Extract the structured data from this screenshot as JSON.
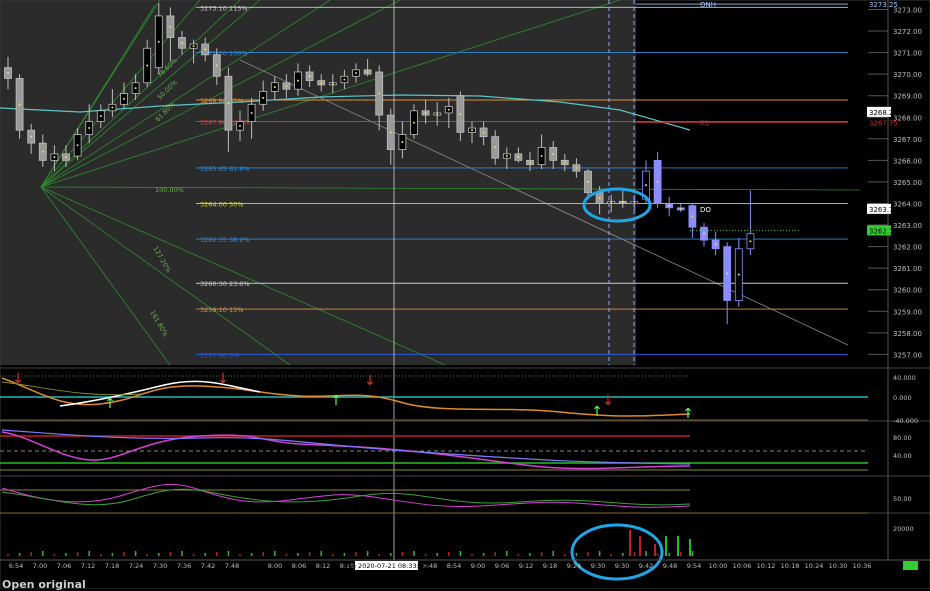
{
  "footer": {
    "open_original": "Open original"
  },
  "colors": {
    "background": "#000000",
    "premarket_bg": "#2b2b2b",
    "rth_bg": "#000000",
    "grid": "#4a4a4a",
    "accent_circle": "#1ea7e8"
  },
  "chart_data": {
    "type": "candlestick",
    "symbol_hint": "S&P futures intraday, 2020-07-21",
    "price_axis": {
      "range": [
        3256.6,
        3273.3
      ],
      "ticks": [
        "3273.00",
        "3272.00",
        "3271.00",
        "3270.00",
        "3269.00",
        "3268.00",
        "3267.00",
        "3266.00",
        "3265.00",
        "3264.00",
        "3263.00",
        "3262.00",
        "3261.00",
        "3260.00",
        "3259.00",
        "3258.00",
        "3257.00"
      ],
      "labels": [
        {
          "text": "3273.25",
          "value": 3273.25,
          "color": "#9fc3ff",
          "style": "plain"
        },
        {
          "text": "3268.25",
          "value": 3268.25,
          "color": "#000000",
          "bg": "#ffffff",
          "style": "box"
        },
        {
          "text": "3267.75",
          "value": 3267.75,
          "color": "#c03030",
          "style": "plain"
        },
        {
          "text": "3263.75",
          "value": 3263.75,
          "color": "#000000",
          "bg": "#ffffff",
          "style": "box"
        },
        {
          "text": "3262.75",
          "value": 3262.75,
          "color": "#000000",
          "bg": "#33cc33",
          "style": "box"
        }
      ]
    },
    "time_axis": {
      "ticks": [
        "6:54",
        "7:00",
        "7:06",
        "7:12",
        "7:18",
        "7:24",
        "7:30",
        "7:36",
        "7:42",
        "7:48",
        "8:00",
        "8:06",
        "8:12",
        "8:18",
        "8:48",
        "8:54",
        "9:00",
        "9:06",
        "9:12",
        "9:18",
        "9:24",
        "9:30",
        "9:30",
        "9:42",
        "9:48",
        "9:54",
        "10:00",
        "10:06",
        "10:12",
        "10:18",
        "10:24",
        "10:30",
        "10:36"
      ],
      "crosshair_label": "Tue 2020-07-21 08:33:00"
    },
    "fib_levels": [
      {
        "label": "3273.10 115%",
        "value": 3273.1,
        "color": "#c9c9c9"
      },
      {
        "label": "3271.00 100%",
        "value": 3271.0,
        "color": "#2e8ad8"
      },
      {
        "label": "3268.80 85%",
        "value": 3268.8,
        "color": "#e0903a"
      },
      {
        "label": "3267.80 76.4%",
        "value": 3267.8,
        "color": "#d84040"
      },
      {
        "label": "3265.65 61.8%",
        "value": 3265.65,
        "color": "#2e8ad8"
      },
      {
        "label": "3264.00 50%",
        "value": 3264.0,
        "color": "#d8d830"
      },
      {
        "label": "3262.35 38.2%",
        "value": 3262.35,
        "color": "#2e8ad8"
      },
      {
        "label": "3260.30 23.6%",
        "value": 3260.3,
        "color": "#c9c9c9"
      },
      {
        "label": "3259.10 15%",
        "value": 3259.1,
        "color": "#e0903a"
      },
      {
        "label": "3257.00 0%",
        "value": 3257.0,
        "color": "#2e5ad8"
      }
    ],
    "fan_labels": [
      {
        "text": "78.60%",
        "color": "#6ab04c"
      },
      {
        "text": "50.00%",
        "color": "#6ab04c"
      },
      {
        "text": "61.80%",
        "color": "#6ab04c"
      },
      {
        "text": "100.00%",
        "color": "#6ab04c"
      },
      {
        "text": "127.20%",
        "color": "#6ab04c"
      },
      {
        "text": "161.80%",
        "color": "#6ab04c"
      }
    ],
    "markers": [
      {
        "text": "ONH",
        "value": 3273.25,
        "color": "#9fc3ff"
      },
      {
        "text": "R1",
        "value": 3267.75,
        "color": "#c03030"
      },
      {
        "text": "DO",
        "value": 3263.75,
        "color": "#ffffff"
      }
    ],
    "candles": [
      {
        "t": 0,
        "o": 3270.3,
        "h": 3270.8,
        "l": 3269.3,
        "c": 3269.8
      },
      {
        "t": 1,
        "o": 3269.8,
        "h": 3270.0,
        "l": 3267.0,
        "c": 3267.4
      },
      {
        "t": 2,
        "o": 3267.4,
        "h": 3267.7,
        "l": 3266.3,
        "c": 3266.8
      },
      {
        "t": 3,
        "o": 3266.8,
        "h": 3267.2,
        "l": 3265.7,
        "c": 3266.0
      },
      {
        "t": 4,
        "o": 3266.0,
        "h": 3266.7,
        "l": 3265.5,
        "c": 3266.3
      },
      {
        "t": 5,
        "o": 3266.3,
        "h": 3266.7,
        "l": 3265.7,
        "c": 3266.0
      },
      {
        "t": 6,
        "o": 3266.2,
        "h": 3267.5,
        "l": 3266.0,
        "c": 3267.2
      },
      {
        "t": 7,
        "o": 3267.2,
        "h": 3268.6,
        "l": 3266.8,
        "c": 3267.8
      },
      {
        "t": 8,
        "o": 3267.8,
        "h": 3268.6,
        "l": 3267.5,
        "c": 3268.3
      },
      {
        "t": 9,
        "o": 3268.3,
        "h": 3269.3,
        "l": 3268.0,
        "c": 3268.6
      },
      {
        "t": 10,
        "o": 3268.6,
        "h": 3269.6,
        "l": 3268.4,
        "c": 3269.1
      },
      {
        "t": 11,
        "o": 3269.1,
        "h": 3270.0,
        "l": 3268.8,
        "c": 3269.6
      },
      {
        "t": 12,
        "o": 3269.6,
        "h": 3271.6,
        "l": 3269.4,
        "c": 3271.2
      },
      {
        "t": 13,
        "o": 3270.3,
        "h": 3273.3,
        "l": 3270.0,
        "c": 3272.7
      },
      {
        "t": 14,
        "o": 3272.7,
        "h": 3273.1,
        "l": 3270.6,
        "c": 3271.7
      },
      {
        "t": 15,
        "o": 3271.7,
        "h": 3272.0,
        "l": 3270.9,
        "c": 3271.2
      },
      {
        "t": 16,
        "o": 3271.2,
        "h": 3271.6,
        "l": 3270.5,
        "c": 3271.4
      },
      {
        "t": 17,
        "o": 3271.4,
        "h": 3271.7,
        "l": 3270.6,
        "c": 3270.9
      },
      {
        "t": 18,
        "o": 3270.9,
        "h": 3271.2,
        "l": 3269.5,
        "c": 3269.9
      },
      {
        "t": 19,
        "o": 3269.9,
        "h": 3270.3,
        "l": 3266.4,
        "c": 3267.4
      },
      {
        "t": 20,
        "o": 3267.4,
        "h": 3268.3,
        "l": 3266.9,
        "c": 3267.8
      },
      {
        "t": 21,
        "o": 3267.8,
        "h": 3268.9,
        "l": 3267.0,
        "c": 3268.6
      },
      {
        "t": 22,
        "o": 3268.6,
        "h": 3269.7,
        "l": 3268.3,
        "c": 3269.2
      },
      {
        "t": 23,
        "o": 3269.2,
        "h": 3269.9,
        "l": 3268.8,
        "c": 3269.6
      },
      {
        "t": 24,
        "o": 3269.6,
        "h": 3270.0,
        "l": 3268.9,
        "c": 3269.3
      },
      {
        "t": 25,
        "o": 3269.3,
        "h": 3270.5,
        "l": 3269.0,
        "c": 3270.1
      },
      {
        "t": 26,
        "o": 3270.1,
        "h": 3270.4,
        "l": 3269.4,
        "c": 3269.7
      },
      {
        "t": 27,
        "o": 3269.7,
        "h": 3270.0,
        "l": 3269.2,
        "c": 3269.5
      },
      {
        "t": 28,
        "o": 3269.5,
        "h": 3270.0,
        "l": 3269.1,
        "c": 3269.6
      },
      {
        "t": 29,
        "o": 3269.6,
        "h": 3270.2,
        "l": 3269.3,
        "c": 3269.9
      },
      {
        "t": 30,
        "o": 3269.9,
        "h": 3270.5,
        "l": 3269.6,
        "c": 3270.2
      },
      {
        "t": 31,
        "o": 3270.2,
        "h": 3270.7,
        "l": 3269.9,
        "c": 3270.0
      },
      {
        "t": 32,
        "o": 3270.1,
        "h": 3270.4,
        "l": 3267.4,
        "c": 3268.1
      },
      {
        "t": 33,
        "o": 3268.1,
        "h": 3268.4,
        "l": 3265.8,
        "c": 3266.5
      },
      {
        "t": 34,
        "o": 3266.5,
        "h": 3267.8,
        "l": 3266.1,
        "c": 3267.2
      },
      {
        "t": 35,
        "o": 3267.2,
        "h": 3268.6,
        "l": 3267.0,
        "c": 3268.3
      },
      {
        "t": 36,
        "o": 3268.3,
        "h": 3268.8,
        "l": 3267.7,
        "c": 3268.1
      },
      {
        "t": 37,
        "o": 3268.1,
        "h": 3268.7,
        "l": 3267.6,
        "c": 3268.2
      },
      {
        "t": 38,
        "o": 3268.2,
        "h": 3268.9,
        "l": 3267.5,
        "c": 3268.5
      },
      {
        "t": 39,
        "o": 3269.0,
        "h": 3269.2,
        "l": 3266.9,
        "c": 3267.3
      },
      {
        "t": 40,
        "o": 3267.3,
        "h": 3267.8,
        "l": 3266.8,
        "c": 3267.5
      },
      {
        "t": 41,
        "o": 3267.5,
        "h": 3267.8,
        "l": 3266.7,
        "c": 3267.1
      },
      {
        "t": 42,
        "o": 3267.1,
        "h": 3267.4,
        "l": 3265.8,
        "c": 3266.1
      },
      {
        "t": 43,
        "o": 3266.1,
        "h": 3266.6,
        "l": 3265.6,
        "c": 3266.3
      },
      {
        "t": 44,
        "o": 3266.3,
        "h": 3266.6,
        "l": 3265.9,
        "c": 3266.0
      },
      {
        "t": 45,
        "o": 3266.0,
        "h": 3266.4,
        "l": 3265.5,
        "c": 3265.8
      },
      {
        "t": 46,
        "o": 3265.8,
        "h": 3267.2,
        "l": 3265.6,
        "c": 3266.6
      },
      {
        "t": 47,
        "o": 3266.6,
        "h": 3266.9,
        "l": 3265.6,
        "c": 3266.0
      },
      {
        "t": 48,
        "o": 3266.0,
        "h": 3266.3,
        "l": 3265.5,
        "c": 3265.8
      },
      {
        "t": 49,
        "o": 3265.8,
        "h": 3266.1,
        "l": 3265.2,
        "c": 3265.5
      },
      {
        "t": 50,
        "o": 3265.5,
        "h": 3265.6,
        "l": 3264.2,
        "c": 3264.5
      },
      {
        "t": 51,
        "o": 3264.5,
        "h": 3264.8,
        "l": 3263.5,
        "c": 3264.0
      },
      {
        "t": 52,
        "o": 3264.0,
        "h": 3264.4,
        "l": 3263.6,
        "c": 3264.1
      },
      {
        "t": 53,
        "o": 3264.1,
        "h": 3264.6,
        "l": 3263.8,
        "c": 3264.0
      },
      {
        "t": 54,
        "o": 3264.0,
        "h": 3264.4,
        "l": 3263.7,
        "c": 3264.1
      },
      {
        "t": 55,
        "o": 3264.2,
        "h": 3266.0,
        "l": 3264.0,
        "c": 3265.5
      },
      {
        "t": 56,
        "o": 3266.0,
        "h": 3266.4,
        "l": 3263.8,
        "c": 3264.0
      },
      {
        "t": 57,
        "o": 3264.0,
        "h": 3264.3,
        "l": 3263.4,
        "c": 3263.8
      },
      {
        "t": 58,
        "o": 3263.8,
        "h": 3264.0,
        "l": 3263.6,
        "c": 3263.7
      },
      {
        "t": 59,
        "o": 3263.9,
        "h": 3264.0,
        "l": 3262.4,
        "c": 3262.9
      },
      {
        "t": 60,
        "o": 3262.9,
        "h": 3263.1,
        "l": 3262.0,
        "c": 3262.3
      },
      {
        "t": 61,
        "o": 3262.3,
        "h": 3262.7,
        "l": 3261.6,
        "c": 3261.9
      },
      {
        "t": 62,
        "o": 3262.0,
        "h": 3262.2,
        "l": 3258.4,
        "c": 3259.5
      },
      {
        "t": 63,
        "o": 3259.5,
        "h": 3262.4,
        "l": 3259.2,
        "c": 3261.9
      },
      {
        "t": 64,
        "o": 3261.9,
        "h": 3264.6,
        "l": 3261.6,
        "c": 3262.6
      }
    ],
    "panels": [
      {
        "name": "trend-oscillator",
        "ticks": [
          "40.000",
          "0.000",
          "-40.000"
        ]
      },
      {
        "name": "stochastic",
        "ticks": [
          "80.00",
          "40.00"
        ]
      },
      {
        "name": "momentum",
        "ticks": [
          "50.00"
        ]
      },
      {
        "name": "volume",
        "ticks": [
          "20000"
        ]
      }
    ],
    "grid": true
  }
}
